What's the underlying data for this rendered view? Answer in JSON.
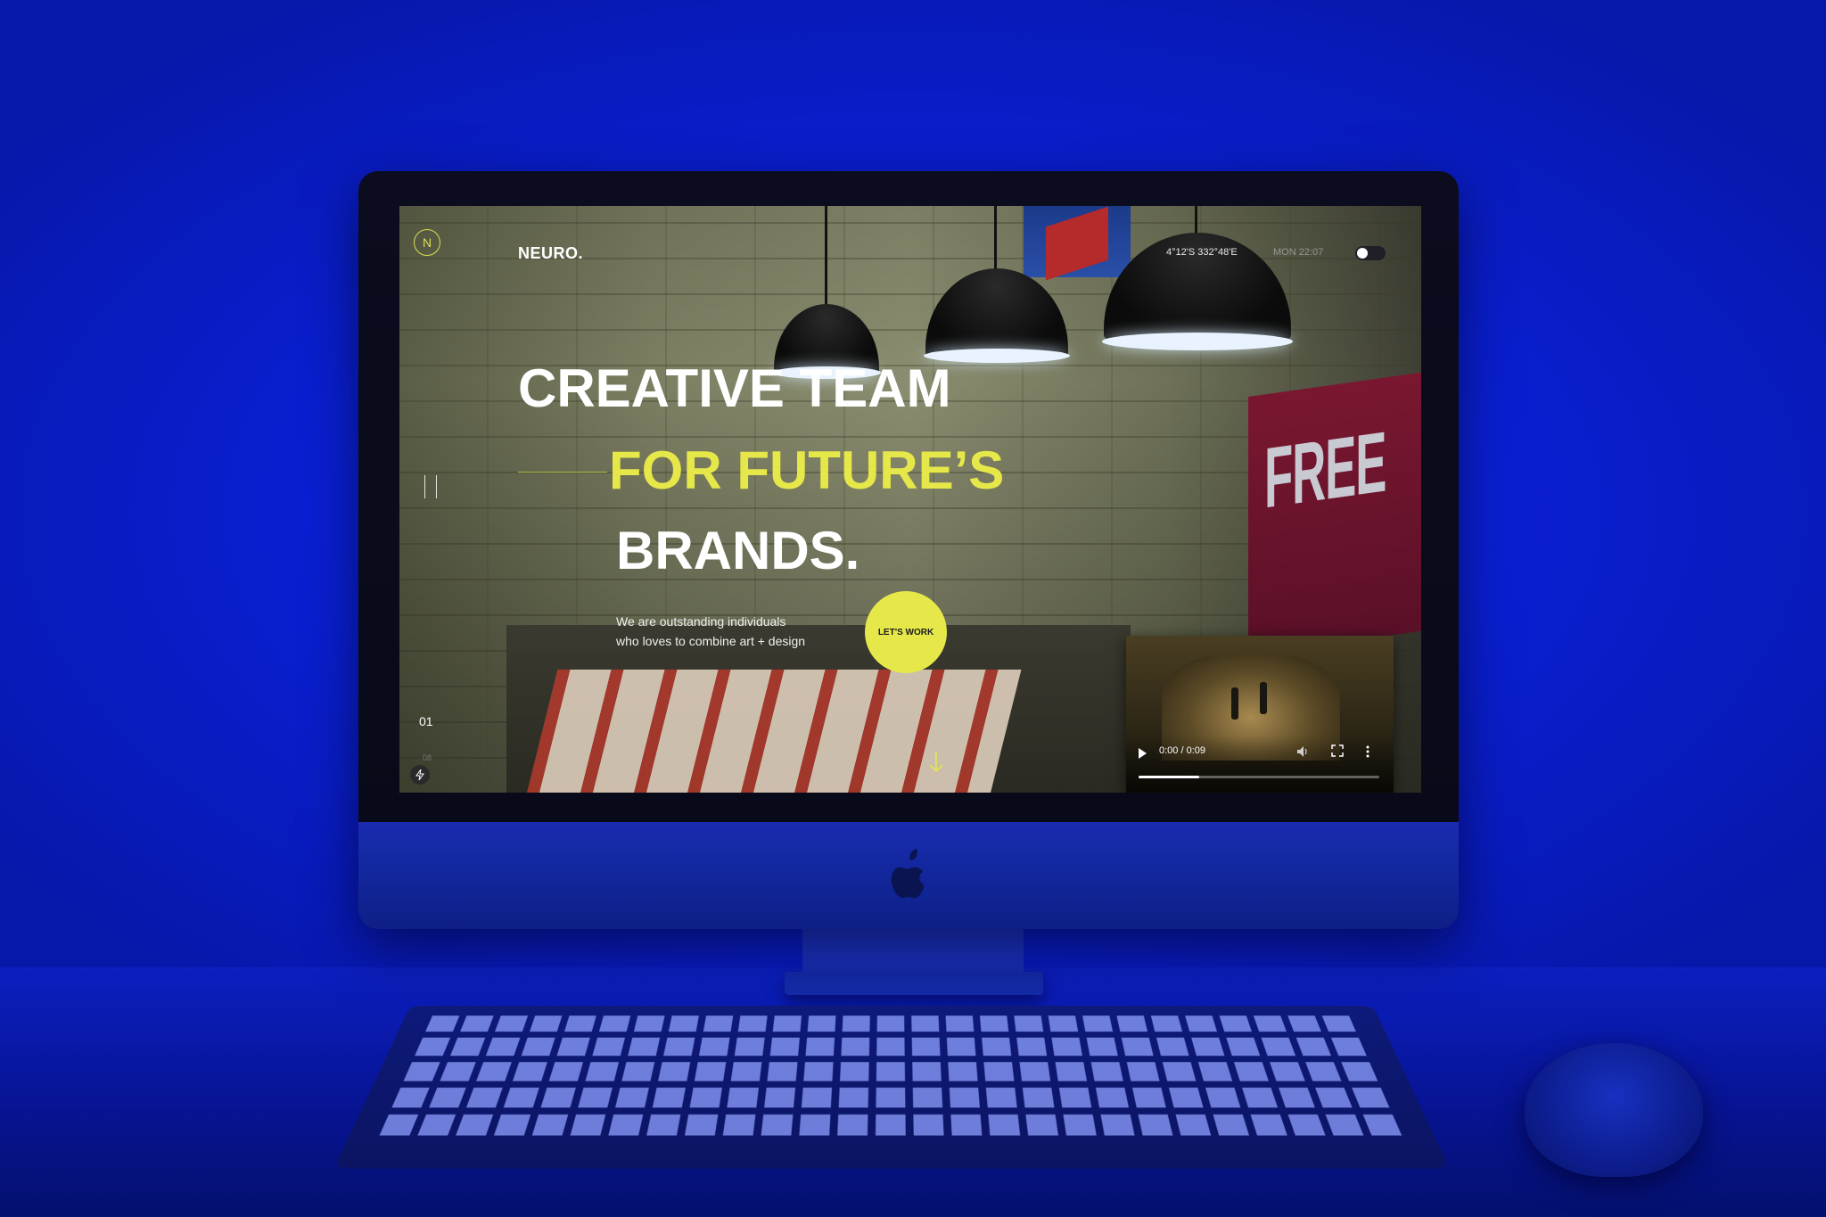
{
  "site": {
    "logo_mark": "N",
    "brand": "NEURO.",
    "coords": "4°12'S 332°48'E",
    "datetime": "MON 22:07",
    "theme_toggle_on": false
  },
  "hero": {
    "line1": "CREATIVE TEAM",
    "line2": "FOR FUTURE’S",
    "line3": "BRANDS.",
    "tagline_1": "We are outstanding individuals",
    "tagline_2": "who loves to combine art + design",
    "cta": "LET'S WORK"
  },
  "slider": {
    "current": "01",
    "total": "08"
  },
  "video": {
    "time": "0:00 / 0:09",
    "progress": 0.25
  },
  "colors": {
    "accent": "#e6e84a",
    "background_light": "#1030ff"
  },
  "icons": [
    "logo-mark-icon",
    "pause-icon",
    "bolt-icon",
    "scroll-down-icon",
    "play-icon",
    "volume-icon",
    "fullscreen-icon",
    "more-icon",
    "apple-icon"
  ]
}
